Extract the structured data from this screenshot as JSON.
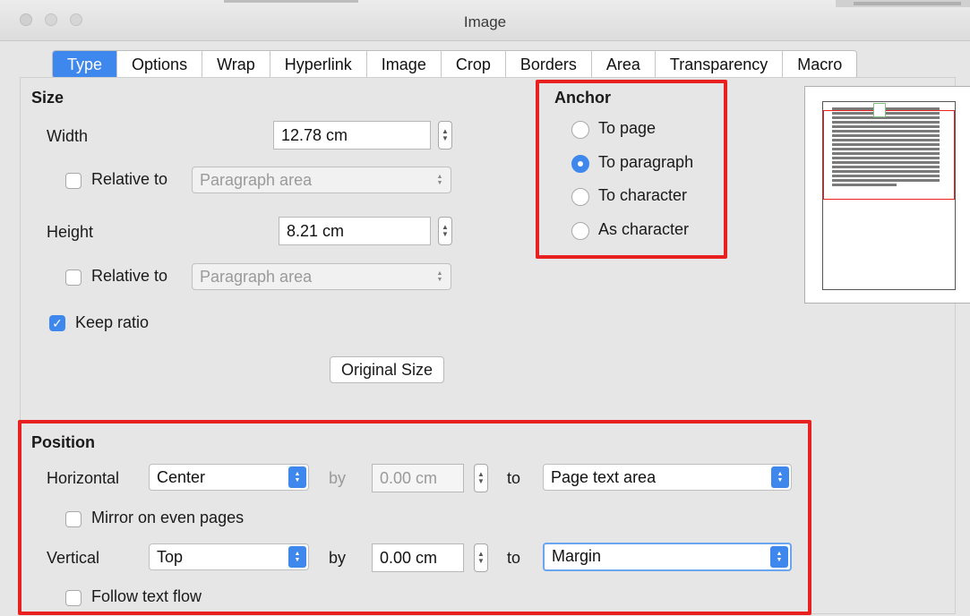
{
  "window": {
    "title": "Image"
  },
  "tabs": [
    {
      "label": "Type",
      "active": true
    },
    {
      "label": "Options"
    },
    {
      "label": "Wrap"
    },
    {
      "label": "Hyperlink"
    },
    {
      "label": "Image"
    },
    {
      "label": "Crop"
    },
    {
      "label": "Borders"
    },
    {
      "label": "Area"
    },
    {
      "label": "Transparency"
    },
    {
      "label": "Macro"
    }
  ],
  "size": {
    "title": "Size",
    "width_label": "Width",
    "width_value": "12.78 cm",
    "width_relative_label": "Relative to",
    "width_relative_value": "Paragraph area",
    "height_label": "Height",
    "height_value": "8.21 cm",
    "height_relative_label": "Relative to",
    "height_relative_value": "Paragraph area",
    "keep_ratio_label": "Keep ratio",
    "keep_ratio_checked": true,
    "original_size_label": "Original Size"
  },
  "anchor": {
    "title": "Anchor",
    "options": [
      {
        "label": "To page",
        "selected": false
      },
      {
        "label": "To paragraph",
        "selected": true
      },
      {
        "label": "To character",
        "selected": false
      },
      {
        "label": "As character",
        "selected": false
      }
    ]
  },
  "position": {
    "title": "Position",
    "horizontal_label": "Horizontal",
    "horizontal_value": "Center",
    "horizontal_by_label": "by",
    "horizontal_by_value": "0.00 cm",
    "horizontal_to_label": "to",
    "horizontal_to_value": "Page text area",
    "mirror_label": "Mirror on even pages",
    "vertical_label": "Vertical",
    "vertical_value": "Top",
    "vertical_by_label": "by",
    "vertical_by_value": "0.00 cm",
    "vertical_to_label": "to",
    "vertical_to_value": "Margin",
    "follow_label": "Follow text flow"
  },
  "colors": {
    "accent": "#3e87ec",
    "highlight": "#e8201f"
  }
}
